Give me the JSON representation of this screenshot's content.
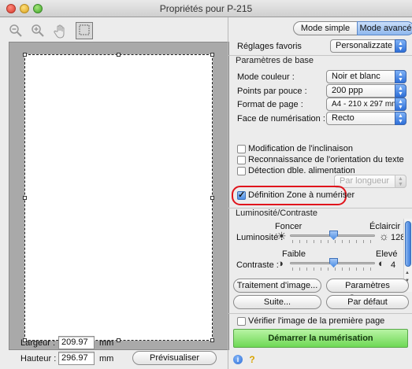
{
  "window": {
    "title": "Propriétés pour P-215"
  },
  "toolbar": {
    "zoom_out_icon": "zoom-out-icon",
    "zoom_in_icon": "zoom-in-icon",
    "hand_icon": "hand-icon",
    "select_icon": "selection-icon"
  },
  "preview": {
    "width_label": "Largeur :",
    "width_value": "209.97",
    "width_unit": "mm",
    "height_label": "Hauteur :",
    "height_value": "296.97",
    "height_unit": "mm",
    "preview_button": "Prévisualiser"
  },
  "mode": {
    "simple": "Mode simple",
    "advanced": "Mode avancé"
  },
  "favorites": {
    "label": "Réglages favoris",
    "value": "Personalizzate"
  },
  "basic": {
    "header": "Paramètres de base",
    "color_mode_label": "Mode couleur :",
    "color_mode_value": "Noir et blanc",
    "dpi_label": "Points par pouce :",
    "dpi_value": "200 ppp",
    "page_format_label": "Format de page :",
    "page_format_value": "A4 - 210 x 297 mm",
    "scan_side_label": "Face de numérisation :",
    "scan_side_value": "Recto"
  },
  "options": {
    "deskew": "Modification de l'inclinaison",
    "orientation": "Reconnaissance de l'orientation du texte",
    "double_feed": "Détection dble. alimentation",
    "double_feed_mode": "Par longueur",
    "scan_area": "Définition Zone à numériser"
  },
  "brightness": {
    "header": "Luminosité/Contraste",
    "darker": "Foncer",
    "lighter": "Éclaircir",
    "brightness_label": "Luminosité :",
    "brightness_value": "128",
    "low": "Faible",
    "high": "Elevé",
    "contrast_label": "Contraste :",
    "contrast_value": "4"
  },
  "buttons": {
    "image_processing": "Traitement d'image...",
    "gamma": "Paramètres Gamma...",
    "more": "Suite...",
    "default": "Par défaut",
    "verify_first_page": "Vérifier l'image de la première page",
    "start": "Démarrer la numérisation"
  }
}
